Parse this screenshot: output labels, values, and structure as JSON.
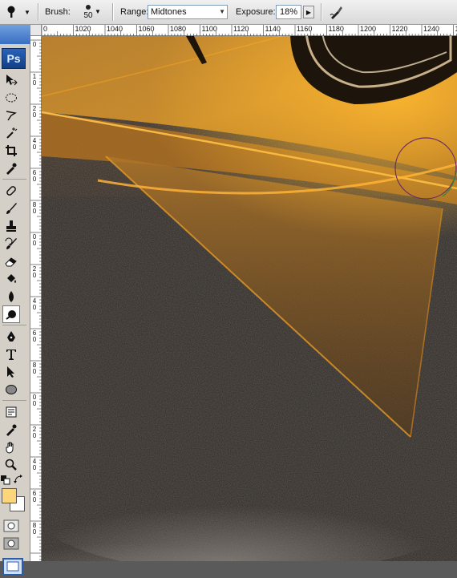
{
  "options_bar": {
    "tool_icon": "burn-tool-icon",
    "brush_label": "Brush:",
    "brush_size": "50",
    "range_label": "Range:",
    "range_value": "Midtones",
    "exposure_label": "Exposure:",
    "exposure_value": "18%",
    "airbrush_icon": "airbrush-icon"
  },
  "toolbox": {
    "logo": "Ps",
    "tools": [
      "move-tool-icon",
      "marquee-tool-icon",
      "lasso-tool-icon",
      "magic-wand-tool-icon",
      "crop-tool-icon",
      "eyedropper-tool-icon",
      "healing-brush-tool-icon",
      "brush-tool-icon",
      "clone-stamp-tool-icon",
      "history-brush-tool-icon",
      "eraser-tool-icon",
      "paint-bucket-tool-icon",
      "blur-tool-icon",
      "burn-tool-icon",
      "pen-tool-icon",
      "type-tool-icon",
      "path-selection-tool-icon",
      "ellipse-shape-tool-icon",
      "notes-tool-icon",
      "eyedropper2-tool-icon",
      "hand-tool-icon",
      "zoom-tool-icon"
    ],
    "active_tool": "burn-tool-icon",
    "foreground_color": "#fdd57a",
    "background_color": "#ffffff"
  },
  "ruler_top": {
    "labels": [
      "0",
      "1020",
      "1040",
      "1060",
      "1080",
      "1100",
      "1120",
      "1140",
      "1160",
      "1180",
      "1200",
      "1220",
      "1240",
      "126"
    ]
  },
  "ruler_left": {
    "labels": [
      "0",
      "10",
      "20",
      "40",
      "60",
      "80",
      "00",
      "20",
      "40",
      "60",
      "80",
      "00",
      "20",
      "40",
      "60",
      "80"
    ]
  },
  "canvas": {
    "accent": "#f0a020",
    "brush_cursor_color": "#6b2a63"
  }
}
